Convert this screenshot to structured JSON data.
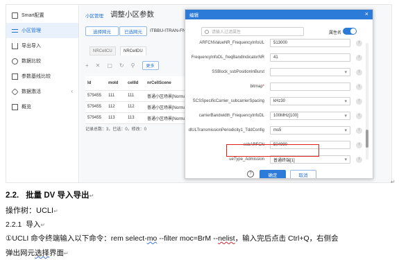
{
  "screenshot": {
    "sidebar": {
      "items": [
        {
          "label": "Smart配置",
          "icon": "home-icon"
        },
        {
          "label": "小区管理",
          "icon": "list-icon",
          "active": true
        },
        {
          "label": "导出导入",
          "icon": "import-icon"
        },
        {
          "label": "数据比较",
          "icon": "compare-icon"
        },
        {
          "label": "参数基线比较",
          "icon": "param-icon"
        },
        {
          "label": "数据激活",
          "icon": "activate-icon",
          "has_chevron": true
        },
        {
          "label": "概览",
          "icon": "overview-icon"
        }
      ]
    },
    "main": {
      "breadcrumb": "小区管理",
      "title": "调整小区参数",
      "buttons": {
        "select_ne": "选择网元",
        "selected_ne": "已选网元"
      },
      "selected_text": "ITBBU-ITRAN-FN",
      "tabs": [
        "NRCellCU",
        "NRCellDU"
      ],
      "more_button": "更多",
      "table": {
        "headers": [
          "Id",
          "moId",
          "cellId",
          "nrCellScene"
        ],
        "rows": [
          [
            "579455",
            "111",
            "111",
            "普通小区场景[Normal"
          ],
          [
            "579455",
            "112",
            "112",
            "普通小区场景[Normal"
          ],
          [
            "579455",
            "113",
            "113",
            "普通小区场景[Normal"
          ]
        ]
      },
      "pager": "记录总数：3，已选：0，修改：0"
    },
    "modal": {
      "title": "编辑",
      "close": "×",
      "search_placeholder": "请输入过滤属性",
      "attr_label": "属性名",
      "fields": [
        {
          "label": "ARFCNValueNR_FrequencyInfoUL",
          "value": "513000",
          "type": "input",
          "required": false
        },
        {
          "label": "FrequencyInfoDL_freqBandIndicatorNR",
          "value": "41",
          "type": "input",
          "required": false
        },
        {
          "label": "SSBlock_ssbPositionInBurst",
          "value": "",
          "type": "select",
          "required": false
        },
        {
          "label": "bitmap",
          "value": "",
          "type": "input",
          "required": true
        },
        {
          "label": "SCSSpecificCarrier_subcarrierSpacing",
          "value": "kHz30",
          "type": "select",
          "required": false
        },
        {
          "label": "carrierBandwidth_FrequencyInfoDL",
          "value": "100MHz[100]",
          "type": "select",
          "required": false
        },
        {
          "label": "dlULTransmissionPeriodicity1_TddConfig",
          "value": "ms5",
          "type": "select",
          "required": false
        },
        {
          "label": "ssbARFCN",
          "value": "504990",
          "type": "input",
          "required": false
        },
        {
          "label": "ueType_Admission",
          "value": "普通终端[1]",
          "type": "select",
          "required": false
        }
      ],
      "required_mark": "*",
      "info_glyph": "!",
      "help_glyph": "?",
      "ok_button": "确定",
      "cancel_button": "取消"
    }
  },
  "document": {
    "section_number": "2.2.",
    "section_title": "批量 DV 导入导出",
    "line1": "操作树：UCLI",
    "sub_number": "2.2.1",
    "sub_title": "导入",
    "step_circle": "①",
    "step_prefix": "UCLI 命令终端输入以下命令：rem select-",
    "step_mo": "mo",
    "step_mid": " --filter moc=BrM --",
    "step_nelist": "nelist",
    "step_suffix": "，输入完后点击 Ctrl+Q，右侧会",
    "step_line2_a": "弹出网元",
    "step_line2_b": "选择",
    "step_line2_c": "界面",
    "paragraph_mark": "↵"
  }
}
